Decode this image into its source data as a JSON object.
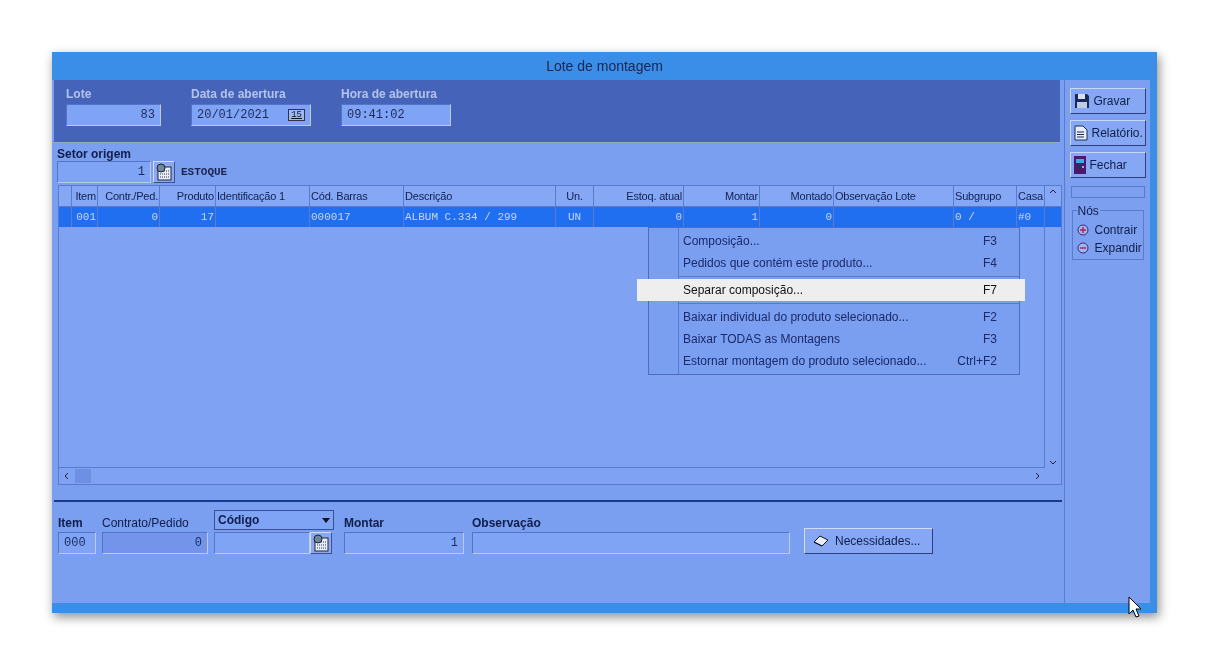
{
  "window": {
    "title": "Lote de montagem"
  },
  "header": [
    {
      "label": "Lote",
      "value": "83",
      "kind": "number"
    },
    {
      "label": "Data de abertura",
      "value": "20/01/2021",
      "kind": "date",
      "button": "15"
    },
    {
      "label": "Hora de abertura",
      "value": "09:41:02",
      "kind": "text"
    }
  ],
  "setor": {
    "label": "Setor origem",
    "value": "1",
    "name": "ESTOQUE"
  },
  "table": {
    "columns": [
      {
        "label": "Item",
        "kind": "number"
      },
      {
        "label": "Contr./Ped.",
        "kind": "number"
      },
      {
        "label": "Produto",
        "kind": "number"
      },
      {
        "label": "Identificação 1",
        "kind": "text"
      },
      {
        "label": "Cód. Barras",
        "kind": "text"
      },
      {
        "label": "Descrição",
        "kind": "text"
      },
      {
        "label": "Un.",
        "kind": "center"
      },
      {
        "label": "Estoq. atual",
        "kind": "number"
      },
      {
        "label": "Montar",
        "kind": "number"
      },
      {
        "label": "Montado",
        "kind": "number"
      },
      {
        "label": "Observação Lote",
        "kind": "text"
      },
      {
        "label": "Subgrupo",
        "kind": "text"
      },
      {
        "label": "Casa",
        "kind": "text"
      }
    ],
    "rows": [
      {
        "selected": true,
        "cells": [
          "001",
          "0",
          "17",
          "",
          "000017",
          "ALBUM C.334 / 299",
          "UN",
          "0",
          "1",
          "0",
          "",
          "0 /",
          "#0"
        ]
      }
    ]
  },
  "context_menu": {
    "groups": [
      [
        {
          "label": "Composição...",
          "shortcut": "F3",
          "selected": false
        },
        {
          "label": "Pedidos que contém este produto...",
          "shortcut": "F4",
          "selected": false
        }
      ],
      [
        {
          "label": "Separar composição...",
          "shortcut": "F7",
          "selected": true
        }
      ],
      [
        {
          "label": "Baixar individual do produto selecionado...",
          "shortcut": "F2",
          "selected": false
        },
        {
          "label": "Baixar TODAS as Montagens",
          "shortcut": "F3",
          "selected": false
        },
        {
          "label": "Estornar montagem do produto selecionado...",
          "shortcut": "Ctrl+F2",
          "selected": false
        }
      ]
    ]
  },
  "form": {
    "item": {
      "label": "Item",
      "value": "000"
    },
    "contrato": {
      "label": "Contrato/Pedido",
      "value": "0"
    },
    "codigo": {
      "label": "Código"
    },
    "montar": {
      "label": "Montar",
      "value": "1"
    },
    "observacao": {
      "label": "Observação"
    },
    "button": {
      "label": "Necessidades..."
    }
  },
  "sidebar": {
    "buttons": [
      {
        "label": "Gravar",
        "kind": "save"
      },
      {
        "label": "Relatório.",
        "kind": "report"
      },
      {
        "label": "Fechar",
        "kind": "exit"
      }
    ],
    "group": {
      "title": "Nós",
      "items": [
        {
          "label": "Contrair",
          "kind": "collapse"
        },
        {
          "label": "Expandir",
          "kind": "expand"
        }
      ]
    }
  }
}
